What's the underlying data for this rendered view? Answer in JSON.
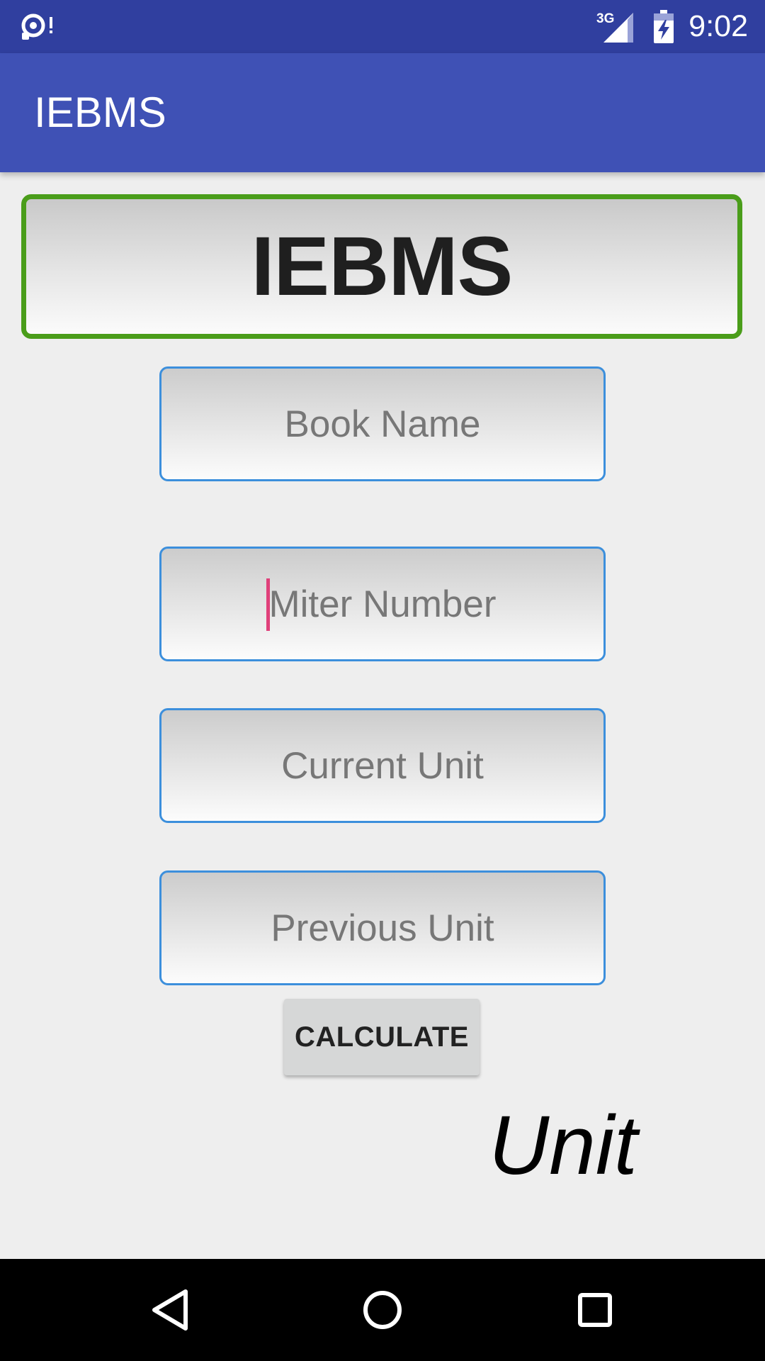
{
  "status_bar": {
    "time": "9:02",
    "network_label": "3G",
    "left_icon": "sync-alert-icon",
    "signal_icon": "cellular-signal-icon",
    "battery_icon": "battery-charging-icon"
  },
  "app_bar": {
    "title": "IEBMS",
    "color": "#3f51b5"
  },
  "header": {
    "title": "IEBMS",
    "border_color": "#4a9d1a"
  },
  "form": {
    "book_name_placeholder": "Book Name",
    "miter_number_placeholder": "Miter Number",
    "current_unit_placeholder": "Current Unit",
    "previous_unit_placeholder": "Previous Unit",
    "field_border_color": "#3c8fdc"
  },
  "calculate_button": {
    "label": "CALCULATE"
  },
  "result": {
    "label": "Unit"
  },
  "nav_bar": {
    "back_icon": "back-triangle-icon",
    "home_icon": "home-circle-icon",
    "recent_icon": "recent-apps-square-icon"
  }
}
